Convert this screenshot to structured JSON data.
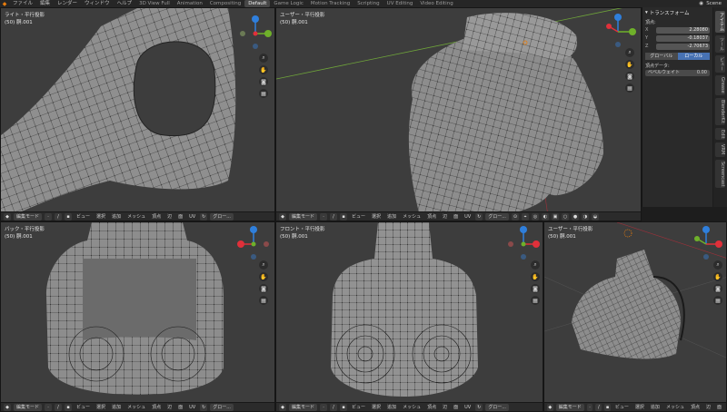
{
  "topbar": {
    "logo": "◆",
    "menus": [
      "ファイル",
      "編集",
      "レンダー",
      "ウィンドウ",
      "ヘルプ"
    ],
    "workspaces": [
      "3D View Full",
      "Animation",
      "Compositing",
      "Default",
      "Game Logic",
      "Motion Tracking",
      "Scripting",
      "UV Editing",
      "Video Editing"
    ],
    "active_workspace": "Default",
    "scene": "Scene"
  },
  "viewports": {
    "right": {
      "title": "ライト・平行投影",
      "sub": "(50) 胴.001"
    },
    "user_top": {
      "title": "ユーザー・平行投影",
      "sub": "(50) 胴.001"
    },
    "back": {
      "title": "バック・平行投影",
      "sub": "(50) 胴.001"
    },
    "front": {
      "title": "フロント・平行投影",
      "sub": "(50) 胴.001"
    },
    "user_bottom": {
      "title": "ユーザー・平行投影",
      "sub": "(50) 胴.001"
    }
  },
  "header": {
    "mode": "編集モード",
    "view": "ビュー",
    "select": "選択",
    "add": "追加",
    "mesh": "メッシュ",
    "vertex": "頂点",
    "edge": "辺",
    "face": "面",
    "uv": "UV",
    "orientation": "グロー..."
  },
  "npanel": {
    "title": "トランスフォーム",
    "vertex_label": "頂点:",
    "x_label": "X",
    "x_value": "2.28080",
    "y_label": "Y",
    "y_value": "-0.18037",
    "z_label": "Z",
    "z_value": "-2.70673",
    "global": "グローバル",
    "local": "ローカル",
    "vertex_data": "頂点データ:",
    "bevel_weight_label": "ベベルウェイト",
    "bevel_weight_value": "0.00"
  },
  "tabs": [
    "アイテム",
    "ツール",
    "ビュー",
    "Grease",
    "BlenderKit",
    "Edit",
    "VRM",
    "Screencast"
  ],
  "colors": {
    "x_axis": "#e0303a",
    "y_axis": "#6fb12a",
    "z_axis": "#2f7fdc",
    "mesh": "#8e8e8e",
    "wire": "#1a1a1a",
    "active": "#4772b3"
  }
}
